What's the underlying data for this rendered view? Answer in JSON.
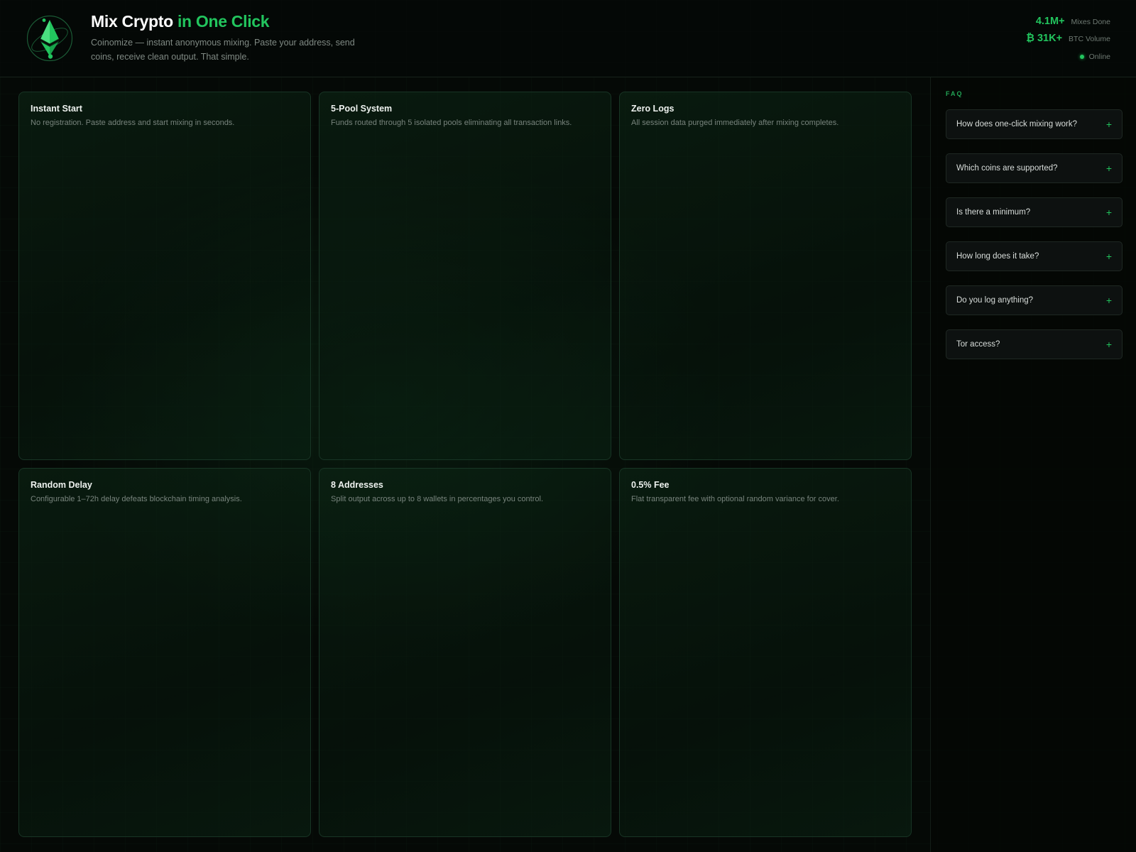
{
  "header": {
    "title_main": "Mix Crypto",
    "title_accent": "in One Click",
    "tagline": "Coinomize — instant anonymous mixing. Paste your address, send coins, receive clean output. That simple.",
    "logo_icon": "ethereum-diamond-icon",
    "stats": [
      {
        "value": "4.1M+",
        "label": "Mixes Done"
      },
      {
        "value": "₿ 31K+",
        "label": "BTC Volume"
      }
    ],
    "status": "Online"
  },
  "features": [
    {
      "title": "Instant Start",
      "desc": "No registration. Paste address and start mixing in seconds."
    },
    {
      "title": "5-Pool System",
      "desc": "Funds routed through 5 isolated pools eliminating all transaction links."
    },
    {
      "title": "Zero Logs",
      "desc": "All session data purged immediately after mixing completes."
    },
    {
      "title": "Random Delay",
      "desc": "Configurable 1–72h delay defeats blockchain timing analysis."
    },
    {
      "title": "8 Addresses",
      "desc": "Split output across up to 8 wallets in percentages you control."
    },
    {
      "title": "0.5% Fee",
      "desc": "Flat transparent fee with optional random variance for cover."
    }
  ],
  "faq": {
    "heading": "FAQ",
    "expand_icon": "plus-icon",
    "items": [
      {
        "question": "How does one-click mixing work?"
      },
      {
        "question": "Which coins are supported?"
      },
      {
        "question": "Is there a minimum?"
      },
      {
        "question": "How long does it take?"
      },
      {
        "question": "Do you log anything?"
      },
      {
        "question": "Tor access?"
      }
    ]
  },
  "colors": {
    "accent": "#22c55e",
    "background": "#050906",
    "card_border": "#183525"
  }
}
